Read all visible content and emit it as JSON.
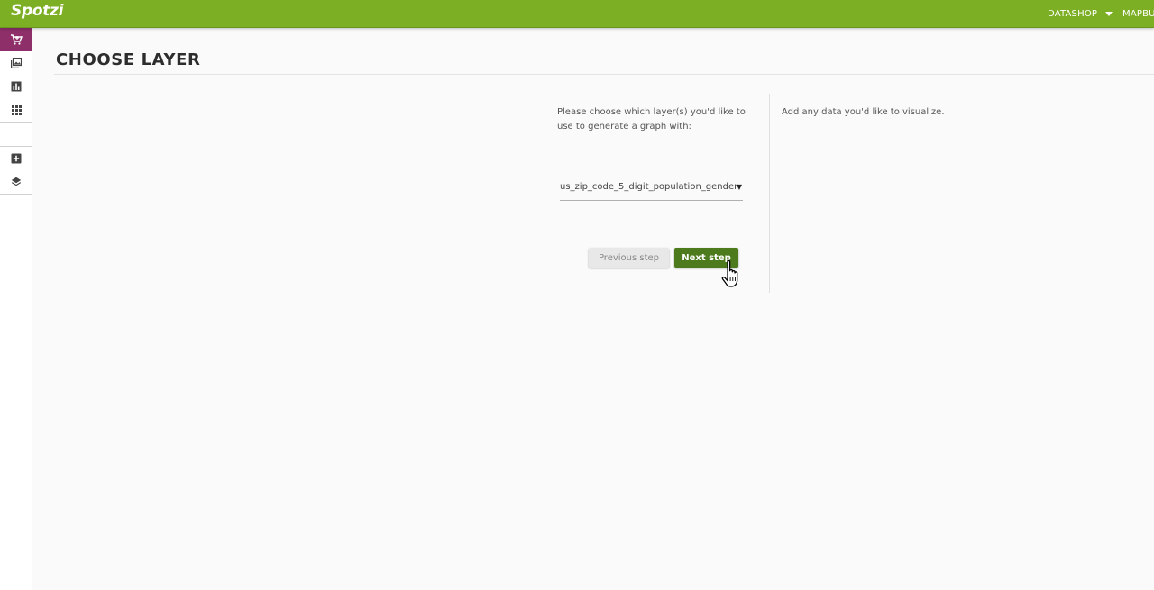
{
  "header": {
    "logo_text": "Spotzi",
    "nav": [
      {
        "label": "DATASHOP",
        "has_dropdown": true
      },
      {
        "label": "MAPBU"
      }
    ],
    "color": "#7daf25"
  },
  "sidebar": {
    "items": [
      {
        "icon": "cart-icon",
        "active": true
      },
      {
        "icon": "images-icon"
      },
      {
        "icon": "bar-chart-icon"
      },
      {
        "icon": "grid-apps-icon"
      },
      {
        "icon": "add-box-icon"
      },
      {
        "icon": "layers-icon"
      }
    ],
    "active_color": "#8e2f6a"
  },
  "main": {
    "title": "CHOOSE LAYER",
    "instruction": "Please choose which layer(s) you'd like to use to generate a graph with:",
    "layer_select": {
      "value": "us_zip_code_5_digit_population_gender",
      "arrow": "▼"
    },
    "buttons": {
      "previous": "Previous step",
      "next": "Next step"
    },
    "side_note": "Add any data you'd like to visualize."
  }
}
